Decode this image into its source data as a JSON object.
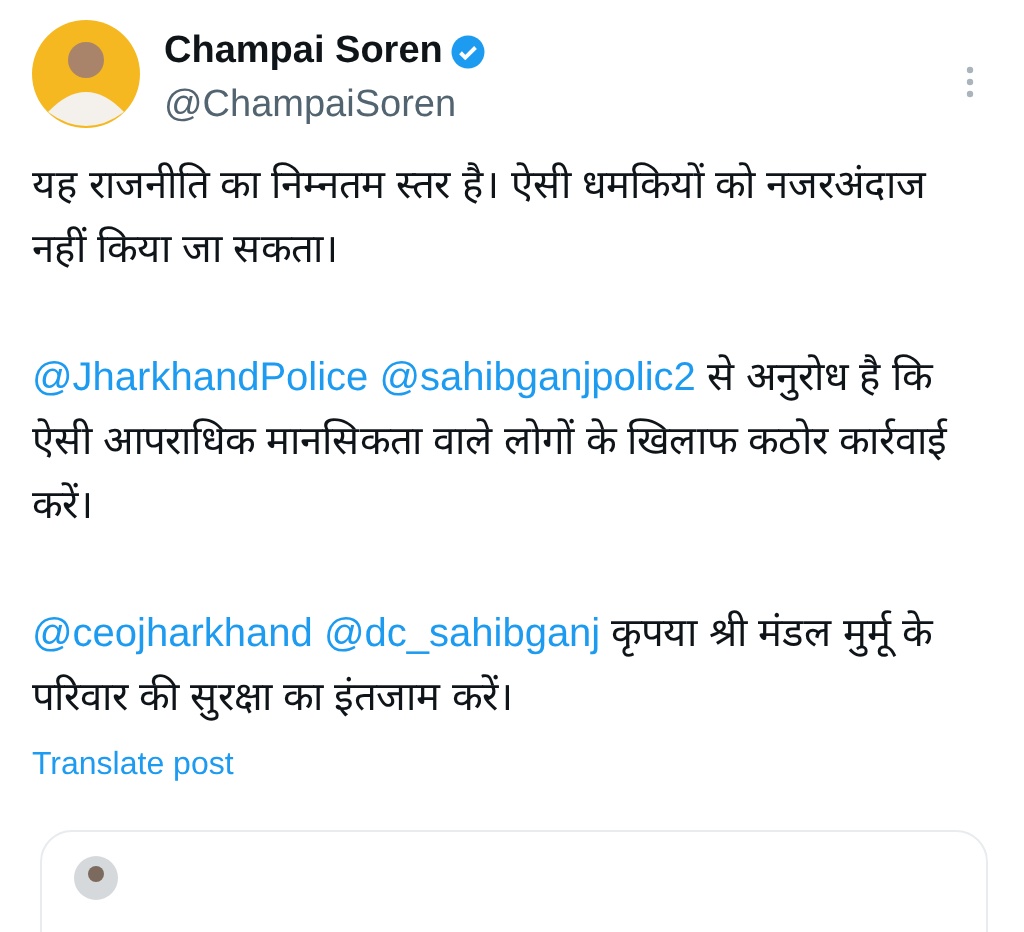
{
  "author": {
    "name": "Champai Soren",
    "verified": true,
    "handle": "@ChampaiSoren"
  },
  "paragraphs": [
    [
      {
        "kind": "text",
        "text": "यह राजनीति का निम्नतम स्तर है। ऐसी धमकियों को नजरअंदाज नहीं किया जा सकता।"
      }
    ],
    [
      {
        "kind": "mention",
        "text": "@JharkhandPolice"
      },
      {
        "kind": "mention",
        "text": "@sahibganjpolic2"
      },
      {
        "kind": "text",
        "text": "से अनुरोध है कि ऐसी आपराधिक मानसिकता वाले लोगों के खिलाफ कठोर कार्रवाई करें।"
      }
    ],
    [
      {
        "kind": "mention",
        "text": "@ceojharkhand"
      },
      {
        "kind": "mention",
        "text": "@dc_sahibganj"
      },
      {
        "kind": "text",
        "text": "कृपया श्री मंडल मुर्मू के परिवार की सुरक्षा का इंतजाम करें।"
      }
    ]
  ],
  "translate_link": "Translate post"
}
